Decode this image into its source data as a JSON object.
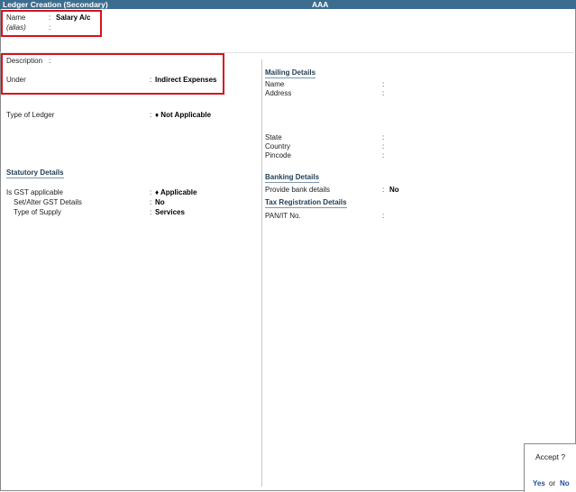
{
  "title_bar": {
    "title": "Ledger Creation (Secondary)",
    "company": "AAA"
  },
  "name_section": {
    "name_label": "Name",
    "name_value": "Salary A/c",
    "alias_label": "(alias)",
    "alias_value": ""
  },
  "description": {
    "label": "Description",
    "value": ""
  },
  "under": {
    "label": "Under",
    "value": "Indirect Expenses"
  },
  "type_of_ledger": {
    "label": "Type of Ledger",
    "value": "♦ Not Applicable"
  },
  "statutory": {
    "heading": "Statutory Details",
    "gst_applicable_label": "Is GST applicable",
    "gst_applicable_value": "♦ Applicable",
    "set_alter_label": "Set/Alter GST Details",
    "set_alter_value": "No",
    "type_of_supply_label": "Type of Supply",
    "type_of_supply_value": "Services"
  },
  "mailing": {
    "heading": "Mailing Details",
    "name_label": "Name",
    "address_label": "Address",
    "state_label": "State",
    "country_label": "Country",
    "pincode_label": "Pincode"
  },
  "banking": {
    "heading": "Banking Details",
    "provide_label": "Provide bank details",
    "provide_value": "No"
  },
  "tax": {
    "heading": "Tax Registration Details",
    "pan_label": "PAN/IT No.",
    "pan_value": ""
  },
  "accept": {
    "question": "Accept ?",
    "yes": "Yes",
    "or": "or",
    "no": "No"
  },
  "colon": ":",
  "colors": {
    "title_bg": "#3c6d8e",
    "highlight": "#d4141c",
    "accept_link": "#1d4f9c"
  }
}
